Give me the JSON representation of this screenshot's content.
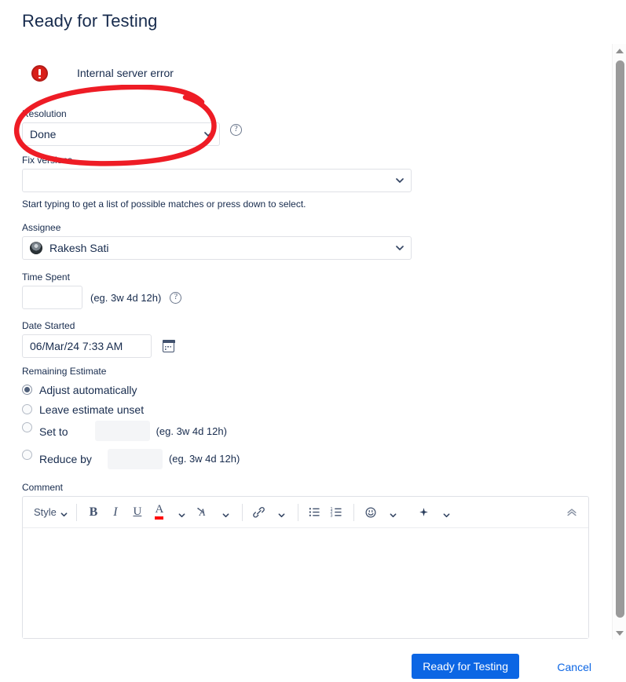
{
  "dialog": {
    "title": "Ready for Testing"
  },
  "error": {
    "icon": "error-circle-icon",
    "message": "Internal server error"
  },
  "fields": {
    "resolution": {
      "label": "Resolution",
      "value": "Done",
      "help_icon": "question-circle-icon"
    },
    "fix_versions": {
      "label": "Fix versions",
      "value": "",
      "hint": "Start typing to get a list of possible matches or press down to select."
    },
    "assignee": {
      "label": "Assignee",
      "value": "Rakesh Sati",
      "avatar": "user-avatar"
    },
    "time_spent": {
      "label": "Time Spent",
      "value": "",
      "hint": "(eg. 3w 4d 12h)",
      "help_icon": "question-circle-icon"
    },
    "date_started": {
      "label": "Date Started",
      "value": "06/Mar/24 7:33 AM",
      "picker_icon": "calendar-icon"
    },
    "remaining_estimate": {
      "label": "Remaining Estimate",
      "options": [
        {
          "label": "Adjust automatically",
          "checked": true,
          "input": null,
          "hint": null
        },
        {
          "label": "Leave estimate unset",
          "checked": false,
          "input": null,
          "hint": null
        },
        {
          "label": "Set to",
          "checked": false,
          "input": "",
          "hint": "(eg. 3w 4d 12h)"
        },
        {
          "label": "Reduce by",
          "checked": false,
          "input": "",
          "hint": "(eg. 3w 4d 12h)"
        }
      ]
    },
    "comment": {
      "label": "Comment",
      "value": "",
      "toolbar": {
        "style_label": "Style",
        "bold": "B",
        "italic": "I",
        "underline": "U",
        "text_color": "A",
        "clear_formatting": "A",
        "link_icon": "link-icon",
        "bullet_list_icon": "bullet-list-icon",
        "numbered_list_icon": "numbered-list-icon",
        "emoji_icon": "emoji-icon",
        "insert_icon": "plus-icon",
        "collapse_icon": "chevron-double-up-icon"
      }
    }
  },
  "footer": {
    "submit_label": "Ready for Testing",
    "cancel_label": "Cancel"
  },
  "scrollbar": {
    "up_icon": "scroll-up-arrow-icon",
    "down_icon": "scroll-down-arrow-icon"
  },
  "annotation": {
    "shape": "hand-drawn-ellipse",
    "color": "#ee1c25"
  },
  "colors": {
    "accent": "#0c66e4",
    "error": "#d91e18",
    "text": "#172b4d",
    "border": "#dfe1e6",
    "annotation": "#ee1c25"
  }
}
